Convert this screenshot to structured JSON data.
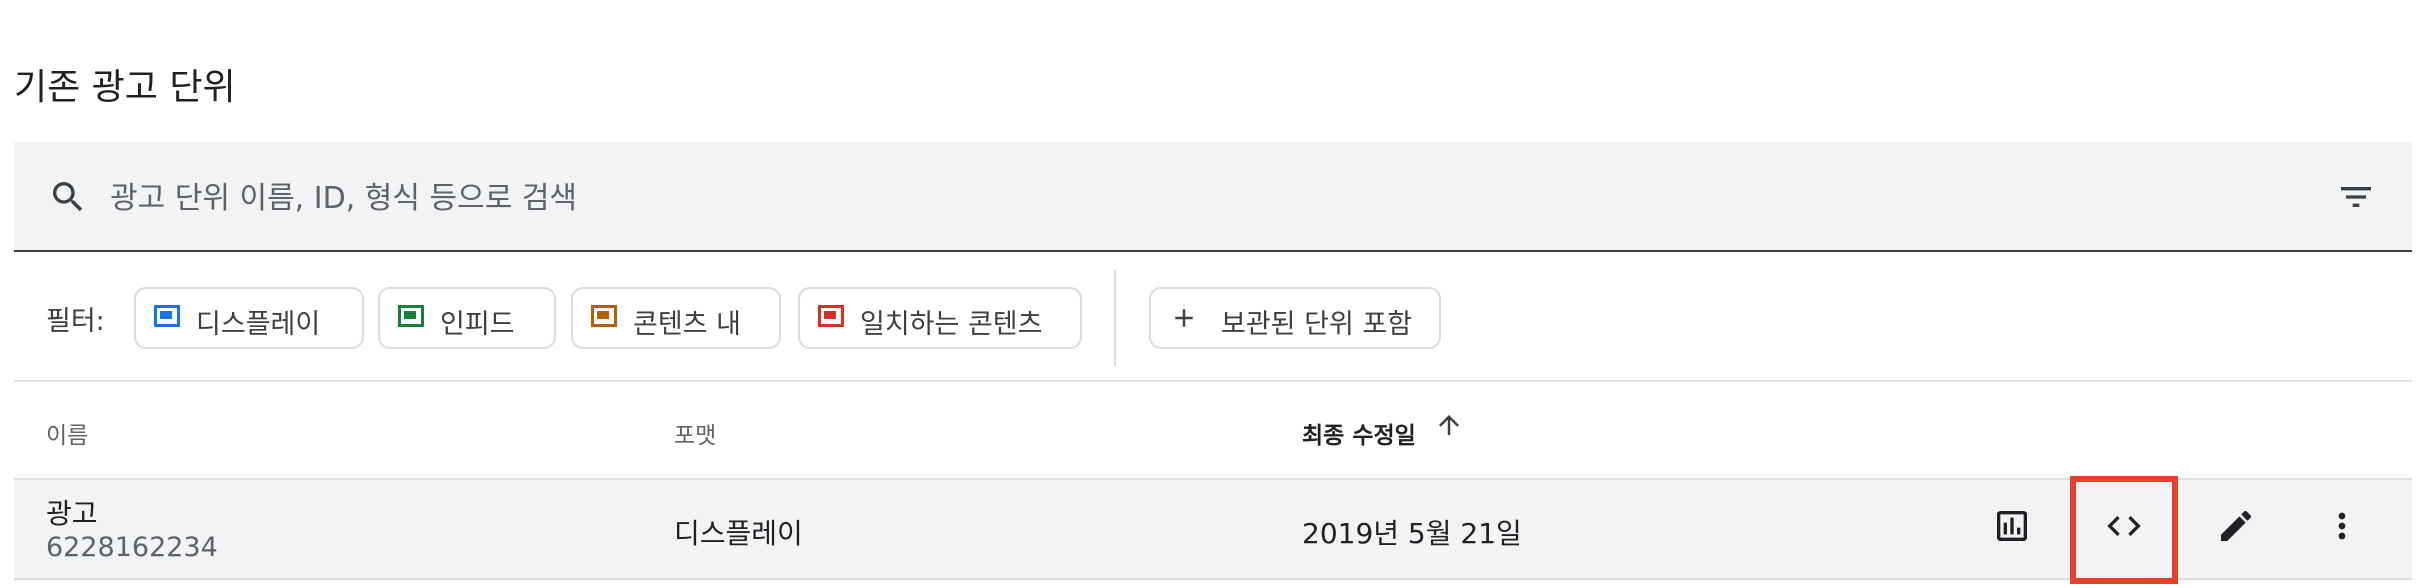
{
  "page": {
    "title": "기존 광고 단위"
  },
  "search": {
    "placeholder": "광고 단위 이름, ID, 형식 등으로 검색"
  },
  "filters": {
    "label": "필터:",
    "chips": [
      {
        "label": "디스플레이",
        "color": "#1a73e8"
      },
      {
        "label": "인피드",
        "color": "#188038"
      },
      {
        "label": "콘텐츠 내",
        "color": "#b06000"
      },
      {
        "label": "일치하는 콘텐츠",
        "color": "#d93025"
      }
    ],
    "archived": {
      "label": "보관된 단위 포함"
    }
  },
  "table": {
    "columns": [
      {
        "label": "이름"
      },
      {
        "label": "포맷"
      },
      {
        "label": "최종 수정일",
        "sorted": "ascending"
      }
    ],
    "rows": [
      {
        "name": "광고",
        "id": "6228162234",
        "format": "디스플레이",
        "modified": "2019년 5월 21일"
      }
    ],
    "row_actions": [
      "bar-chart-icon",
      "code-icon",
      "edit-pencil-icon",
      "more-vert-icon"
    ]
  },
  "highlight_color": "#e8402a"
}
